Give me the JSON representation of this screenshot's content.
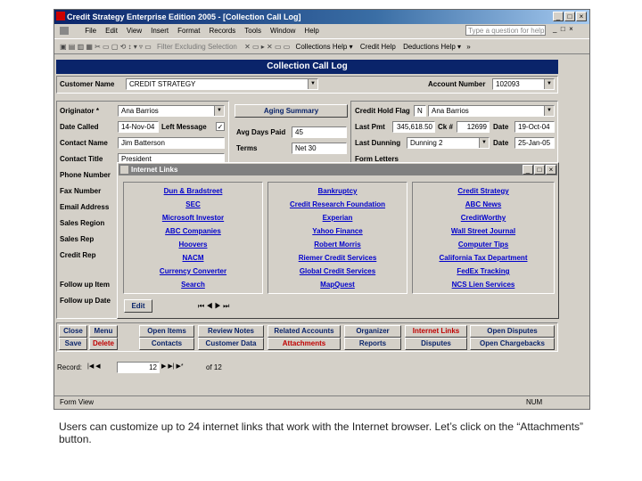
{
  "window": {
    "title": "Credit Strategy Enterprise Edition 2005 - [Collection Call Log]",
    "min": "_",
    "max": "□",
    "close": "×",
    "help_placeholder": "Type a question for help"
  },
  "menu": [
    "File",
    "Edit",
    "View",
    "Insert",
    "Format",
    "Records",
    "Tools",
    "Window",
    "Help"
  ],
  "toolbar": {
    "filter": "Filter Excluding Selection",
    "collections_help": "Collections Help ▾",
    "credit_help": "Credit Help",
    "deductions_help": "Deductions Help ▾",
    "more": "»"
  },
  "form": {
    "header": "Collection Call Log",
    "customer_name_label": "Customer Name",
    "customer_name": "CREDIT STRATEGY",
    "account_number_label": "Account Number",
    "account_number": "102093",
    "left": {
      "originator_label": "Originator *",
      "originator": "Ana Barrios",
      "date_called_label": "Date Called",
      "date_called": "14-Nov-04",
      "left_message_label": "Left Message",
      "contact_name_label": "Contact Name",
      "contact_name": "Jim Batterson",
      "contact_title_label": "Contact Title",
      "contact_title": "President",
      "phone_label": "Phone Number",
      "fax_label": "Fax Number",
      "email_label": "Email Address",
      "sales_region_label": "Sales Region",
      "sales_rep_label": "Sales Rep",
      "credit_rep_label": "Credit Rep",
      "follow_up_item_label": "Follow up Item",
      "follow_up_date_label": "Follow up Date"
    },
    "middle": {
      "aging_button": "Aging Summary",
      "avg_days_label": "Avg Days Paid",
      "avg_days": "45",
      "terms_label": "Terms",
      "terms": "Net 30"
    },
    "right": {
      "hold_flag_label": "Credit Hold Flag",
      "hold_flag": "N",
      "hold_name": "Ana Barrios",
      "last_pmt_label": "Last Pmt",
      "last_pmt": "345,618.50",
      "ck_label": "Ck #",
      "ck": "12699",
      "date_label": "Date",
      "last_pmt_date": "19-Oct-04",
      "last_dunning_label": "Last Dunning",
      "last_dunning": "Dunning 2",
      "dunning_date": "25-Jan-05",
      "form_letters_label": "Form Letters"
    }
  },
  "internet_links": {
    "title": "Internet Links",
    "col1": [
      "Dun & Bradstreet",
      "SEC",
      "Microsoft Investor",
      "ABC Companies",
      "Hoovers",
      "NACM",
      "Currency Converter",
      "Search"
    ],
    "col2": [
      "Bankruptcy",
      "Credit Research Foundation",
      "Experian",
      "Yahoo Finance",
      "Robert Morris",
      "Riemer Credit Services",
      "Global Credit Services",
      "MapQuest"
    ],
    "col3": [
      "Credit Strategy",
      "ABC News",
      "CreditWorthy",
      "Wall Street Journal",
      "Computer Tips",
      "California Tax Department",
      "FedEx Tracking",
      "NCS Lien Services"
    ],
    "edit": "Edit"
  },
  "buttons": {
    "row1": [
      "Close",
      "Menu",
      "Open Items",
      "Review Notes",
      "Related Accounts",
      "Organizer",
      "Internet Links",
      "Open Disputes"
    ],
    "row2": [
      "Save",
      "Delete",
      "Contacts",
      "Customer Data",
      "Attachments",
      "Reports",
      "Disputes",
      "Open Chargebacks"
    ]
  },
  "record_nav": {
    "label": "Record:",
    "current": "12",
    "of": "of  12"
  },
  "status": {
    "view": "Form View",
    "num": "NUM"
  },
  "caption": "Users can customize up to 24 internet links that work with the Internet browser. Let’s click on the “Attachments” button."
}
